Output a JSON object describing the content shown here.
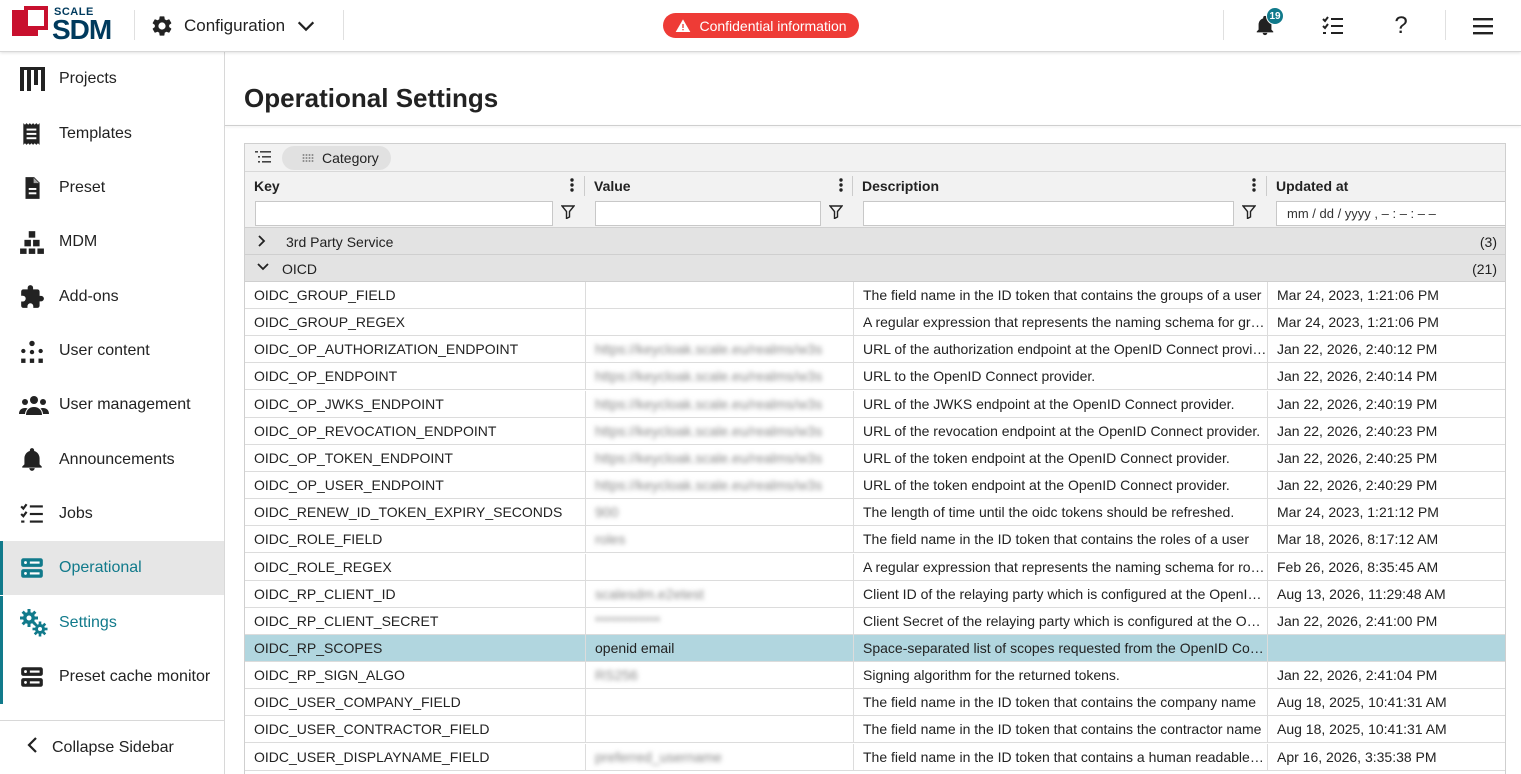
{
  "app": {
    "logo_top": "SCALE",
    "logo_main": "SDM",
    "workspace": "Configuration",
    "confidential_label": "Confidential information",
    "notification_count": "19",
    "help_glyph": "?"
  },
  "sidebar": {
    "items": [
      {
        "label": "Projects",
        "icon": "bar-chart-icon"
      },
      {
        "label": "Templates",
        "icon": "receipt-icon"
      },
      {
        "label": "Preset",
        "icon": "document-icon"
      },
      {
        "label": "MDM",
        "icon": "hierarchy-icon"
      },
      {
        "label": "Add-ons",
        "icon": "puzzle-icon"
      },
      {
        "label": "User content",
        "icon": "user-content-icon"
      },
      {
        "label": "User management",
        "icon": "users-icon"
      },
      {
        "label": "Announcements",
        "icon": "bell-icon"
      },
      {
        "label": "Jobs",
        "icon": "checklist-icon"
      },
      {
        "label": "Operational",
        "icon": "server-icon"
      },
      {
        "label": "Settings",
        "icon": "gears-icon"
      },
      {
        "label": "Preset cache monitor",
        "icon": "server-icon"
      }
    ],
    "collapse_label": "Collapse Sidebar"
  },
  "main": {
    "title": "Operational Settings",
    "group_chip": "Category",
    "columns": {
      "key": "Key",
      "value": "Value",
      "description": "Description",
      "updated": "Updated at"
    },
    "date_placeholder": "mm / dd / yyyy ,  – : – : –   –",
    "groups": [
      {
        "label": "3rd Party Service",
        "count": "(3)"
      },
      {
        "label": "OICD",
        "count": "(21)"
      }
    ],
    "rows": [
      {
        "key": "OIDC_GROUP_FIELD",
        "value": "",
        "description": "The field name in the ID token that contains the groups of a user",
        "updated": "Mar 24, 2023, 1:21:06 PM"
      },
      {
        "key": "OIDC_GROUP_REGEX",
        "value": "",
        "description": "A regular expression that represents the naming schema for groups",
        "updated": "Mar 24, 2023, 1:21:06 PM"
      },
      {
        "key": "OIDC_OP_AUTHORIZATION_ENDPOINT",
        "value": "https://keycloak.scale.eu/realms/w3s",
        "description": "URL of the authorization endpoint at the OpenID Connect provider.",
        "updated": "Jan 22, 2026, 2:40:12 PM"
      },
      {
        "key": "OIDC_OP_ENDPOINT",
        "value": "https://keycloak.scale.eu/realms/w3s",
        "description": "URL to the OpenID Connect provider.",
        "updated": "Jan 22, 2026, 2:40:14 PM"
      },
      {
        "key": "OIDC_OP_JWKS_ENDPOINT",
        "value": "https://keycloak.scale.eu/realms/w3s",
        "description": "URL of the JWKS endpoint at the OpenID Connect provider.",
        "updated": "Jan 22, 2026, 2:40:19 PM"
      },
      {
        "key": "OIDC_OP_REVOCATION_ENDPOINT",
        "value": "https://keycloak.scale.eu/realms/w3s",
        "description": "URL of the revocation endpoint at the OpenID Connect provider.",
        "updated": "Jan 22, 2026, 2:40:23 PM"
      },
      {
        "key": "OIDC_OP_TOKEN_ENDPOINT",
        "value": "https://keycloak.scale.eu/realms/w3s",
        "description": "URL of the token endpoint at the OpenID Connect provider.",
        "updated": "Jan 22, 2026, 2:40:25 PM"
      },
      {
        "key": "OIDC_OP_USER_ENDPOINT",
        "value": "https://keycloak.scale.eu/realms/w3s",
        "description": "URL of the token endpoint at the OpenID Connect provider.",
        "updated": "Jan 22, 2026, 2:40:29 PM"
      },
      {
        "key": "OIDC_RENEW_ID_TOKEN_EXPIRY_SECONDS",
        "value": "900",
        "description": "The length of time until the oidc tokens should be refreshed.",
        "updated": "Mar 24, 2023, 1:21:12 PM"
      },
      {
        "key": "OIDC_ROLE_FIELD",
        "value": "roles",
        "description": "The field name in the ID token that contains the roles of a user",
        "updated": "Mar 18, 2026, 8:17:12 AM"
      },
      {
        "key": "OIDC_ROLE_REGEX",
        "value": "",
        "description": "A regular expression that represents the naming schema for roles",
        "updated": "Feb 26, 2026, 8:35:45 AM"
      },
      {
        "key": "OIDC_RP_CLIENT_ID",
        "value": "scalesdm.e2etest",
        "description": "Client ID of the relaying party which is configured at the OpenID Connect provider",
        "updated": "Aug 13, 2026, 11:29:48 AM"
      },
      {
        "key": "OIDC_RP_CLIENT_SECRET",
        "value": "************",
        "description": "Client Secret of the relaying party which is configured at the OpenID Connect provider",
        "updated": "Jan 22, 2026, 2:41:00 PM"
      },
      {
        "key": "OIDC_RP_SCOPES",
        "value": "openid email",
        "description": "Space-separated list of scopes requested from the OpenID Connect provider",
        "updated": ""
      },
      {
        "key": "OIDC_RP_SIGN_ALGO",
        "value": "RS256",
        "description": "Signing algorithm for the returned tokens.",
        "updated": "Jan 22, 2026, 2:41:04 PM"
      },
      {
        "key": "OIDC_USER_COMPANY_FIELD",
        "value": "",
        "description": "The field name in the ID token that contains the company name",
        "updated": "Aug 18, 2025, 10:41:31 AM"
      },
      {
        "key": "OIDC_USER_CONTRACTOR_FIELD",
        "value": "",
        "description": "The field name in the ID token that contains the contractor name",
        "updated": "Aug 18, 2025, 10:41:31 AM"
      },
      {
        "key": "OIDC_USER_DISPLAYNAME_FIELD",
        "value": "preferred_username",
        "description": "The field name in the ID token that contains a human readable name",
        "updated": "Apr 16, 2026, 3:35:38 PM"
      }
    ]
  },
  "colors": {
    "accent": "#117a8b",
    "brand_red": "#c8102e",
    "confidential": "#ee3b36",
    "selected_row": "#b1d6df"
  }
}
